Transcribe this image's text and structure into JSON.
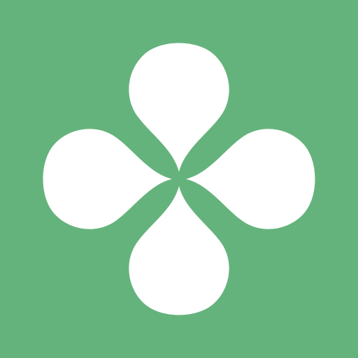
{
  "icon": {
    "name": "four-petal-clover-icon",
    "background_color": "#65b37c",
    "foreground_color": "#ffffff"
  }
}
